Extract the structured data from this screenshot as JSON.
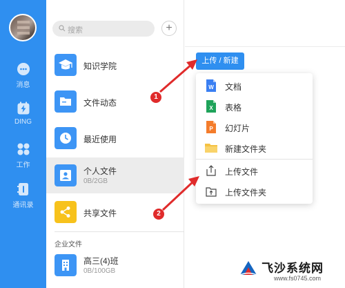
{
  "rail": {
    "items": [
      {
        "label": "消息",
        "icon": "chat-bubble-icon"
      },
      {
        "label": "DING",
        "icon": "ding-bolt-icon"
      },
      {
        "label": "工作",
        "icon": "grid-apps-icon"
      },
      {
        "label": "通讯录",
        "icon": "contacts-book-icon"
      }
    ]
  },
  "search": {
    "placeholder": "搜索"
  },
  "files": {
    "items": [
      {
        "title": "知识学院",
        "sub": "",
        "icon": "graduation-cap-icon",
        "color": "#3d95f5"
      },
      {
        "title": "文件动态",
        "sub": "",
        "icon": "folder-icon",
        "color": "#3d95f5"
      },
      {
        "title": "最近使用",
        "sub": "",
        "icon": "clock-icon",
        "color": "#3d95f5"
      },
      {
        "title": "个人文件",
        "sub": "0B/2GB",
        "icon": "person-icon",
        "color": "#3d95f5"
      },
      {
        "title": "共享文件",
        "sub": "",
        "icon": "share-icon",
        "color": "#f7c21c"
      },
      {
        "title": "高三(4)班",
        "sub": "0B/100GB",
        "icon": "building-icon",
        "color": "#3d95f5"
      }
    ],
    "section_label": "企业文件"
  },
  "upload": {
    "label": "上传 / 新建"
  },
  "menu": {
    "items": [
      {
        "label": "文档",
        "icon": "word-doc-icon",
        "glyph": "W",
        "color": "#3a7ff2"
      },
      {
        "label": "表格",
        "icon": "excel-sheet-icon",
        "glyph": "X",
        "color": "#1fa35a"
      },
      {
        "label": "幻灯片",
        "icon": "slides-icon",
        "glyph": "P",
        "color": "#f47c2b"
      },
      {
        "label": "新建文件夹",
        "icon": "new-folder-icon",
        "glyph": "",
        "color": "#f5c243"
      },
      {
        "label": "上传文件",
        "icon": "upload-file-icon",
        "glyph": "",
        "color": ""
      },
      {
        "label": "上传文件夹",
        "icon": "upload-folder-icon",
        "glyph": "",
        "color": ""
      }
    ]
  },
  "annotations": {
    "badge1": "1",
    "badge2": "2"
  },
  "watermark": {
    "title": "飞沙系统网",
    "url": "www.fs0745.com"
  },
  "colors": {
    "accent": "#2f8ff0",
    "annotation": "#e02b2b"
  }
}
